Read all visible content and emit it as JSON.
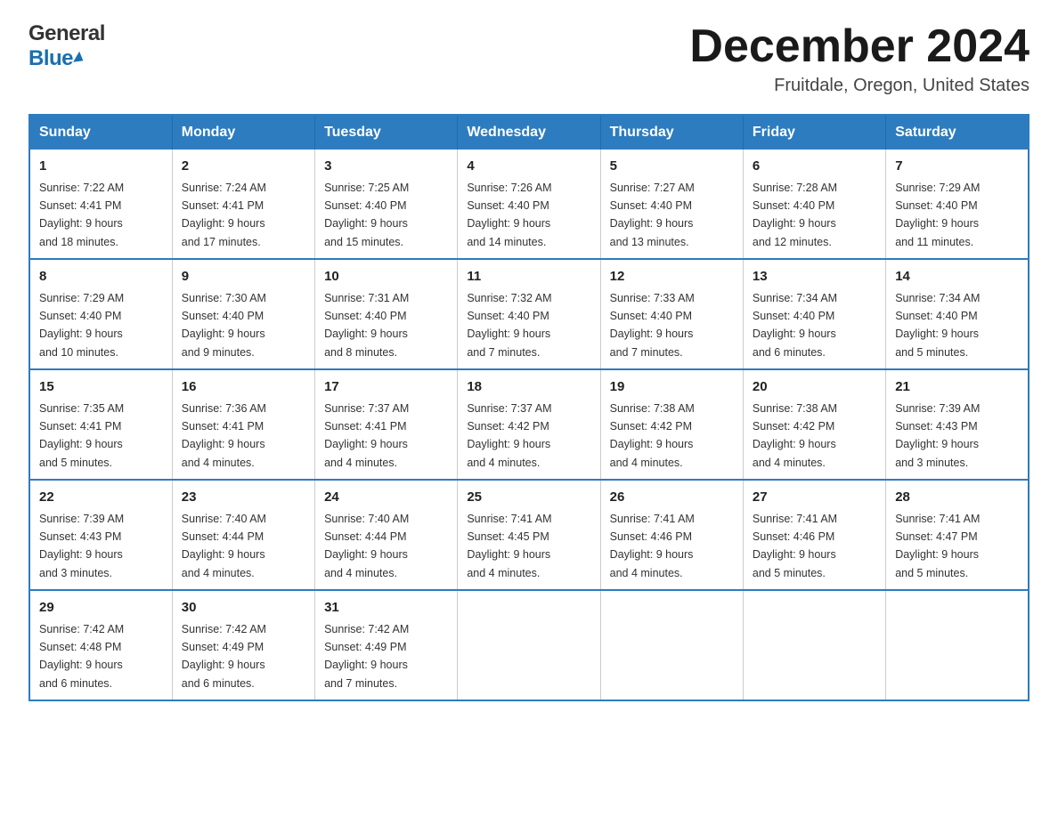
{
  "header": {
    "logo_general": "General",
    "logo_blue": "Blue",
    "month_title": "December 2024",
    "location": "Fruitdale, Oregon, United States"
  },
  "calendar": {
    "days_of_week": [
      "Sunday",
      "Monday",
      "Tuesday",
      "Wednesday",
      "Thursday",
      "Friday",
      "Saturday"
    ],
    "weeks": [
      [
        {
          "day": "1",
          "sunrise": "7:22 AM",
          "sunset": "4:41 PM",
          "daylight": "9 hours and 18 minutes."
        },
        {
          "day": "2",
          "sunrise": "7:24 AM",
          "sunset": "4:41 PM",
          "daylight": "9 hours and 17 minutes."
        },
        {
          "day": "3",
          "sunrise": "7:25 AM",
          "sunset": "4:40 PM",
          "daylight": "9 hours and 15 minutes."
        },
        {
          "day": "4",
          "sunrise": "7:26 AM",
          "sunset": "4:40 PM",
          "daylight": "9 hours and 14 minutes."
        },
        {
          "day": "5",
          "sunrise": "7:27 AM",
          "sunset": "4:40 PM",
          "daylight": "9 hours and 13 minutes."
        },
        {
          "day": "6",
          "sunrise": "7:28 AM",
          "sunset": "4:40 PM",
          "daylight": "9 hours and 12 minutes."
        },
        {
          "day": "7",
          "sunrise": "7:29 AM",
          "sunset": "4:40 PM",
          "daylight": "9 hours and 11 minutes."
        }
      ],
      [
        {
          "day": "8",
          "sunrise": "7:29 AM",
          "sunset": "4:40 PM",
          "daylight": "9 hours and 10 minutes."
        },
        {
          "day": "9",
          "sunrise": "7:30 AM",
          "sunset": "4:40 PM",
          "daylight": "9 hours and 9 minutes."
        },
        {
          "day": "10",
          "sunrise": "7:31 AM",
          "sunset": "4:40 PM",
          "daylight": "9 hours and 8 minutes."
        },
        {
          "day": "11",
          "sunrise": "7:32 AM",
          "sunset": "4:40 PM",
          "daylight": "9 hours and 7 minutes."
        },
        {
          "day": "12",
          "sunrise": "7:33 AM",
          "sunset": "4:40 PM",
          "daylight": "9 hours and 7 minutes."
        },
        {
          "day": "13",
          "sunrise": "7:34 AM",
          "sunset": "4:40 PM",
          "daylight": "9 hours and 6 minutes."
        },
        {
          "day": "14",
          "sunrise": "7:34 AM",
          "sunset": "4:40 PM",
          "daylight": "9 hours and 5 minutes."
        }
      ],
      [
        {
          "day": "15",
          "sunrise": "7:35 AM",
          "sunset": "4:41 PM",
          "daylight": "9 hours and 5 minutes."
        },
        {
          "day": "16",
          "sunrise": "7:36 AM",
          "sunset": "4:41 PM",
          "daylight": "9 hours and 4 minutes."
        },
        {
          "day": "17",
          "sunrise": "7:37 AM",
          "sunset": "4:41 PM",
          "daylight": "9 hours and 4 minutes."
        },
        {
          "day": "18",
          "sunrise": "7:37 AM",
          "sunset": "4:42 PM",
          "daylight": "9 hours and 4 minutes."
        },
        {
          "day": "19",
          "sunrise": "7:38 AM",
          "sunset": "4:42 PM",
          "daylight": "9 hours and 4 minutes."
        },
        {
          "day": "20",
          "sunrise": "7:38 AM",
          "sunset": "4:42 PM",
          "daylight": "9 hours and 4 minutes."
        },
        {
          "day": "21",
          "sunrise": "7:39 AM",
          "sunset": "4:43 PM",
          "daylight": "9 hours and 3 minutes."
        }
      ],
      [
        {
          "day": "22",
          "sunrise": "7:39 AM",
          "sunset": "4:43 PM",
          "daylight": "9 hours and 3 minutes."
        },
        {
          "day": "23",
          "sunrise": "7:40 AM",
          "sunset": "4:44 PM",
          "daylight": "9 hours and 4 minutes."
        },
        {
          "day": "24",
          "sunrise": "7:40 AM",
          "sunset": "4:44 PM",
          "daylight": "9 hours and 4 minutes."
        },
        {
          "day": "25",
          "sunrise": "7:41 AM",
          "sunset": "4:45 PM",
          "daylight": "9 hours and 4 minutes."
        },
        {
          "day": "26",
          "sunrise": "7:41 AM",
          "sunset": "4:46 PM",
          "daylight": "9 hours and 4 minutes."
        },
        {
          "day": "27",
          "sunrise": "7:41 AM",
          "sunset": "4:46 PM",
          "daylight": "9 hours and 5 minutes."
        },
        {
          "day": "28",
          "sunrise": "7:41 AM",
          "sunset": "4:47 PM",
          "daylight": "9 hours and 5 minutes."
        }
      ],
      [
        {
          "day": "29",
          "sunrise": "7:42 AM",
          "sunset": "4:48 PM",
          "daylight": "9 hours and 6 minutes."
        },
        {
          "day": "30",
          "sunrise": "7:42 AM",
          "sunset": "4:49 PM",
          "daylight": "9 hours and 6 minutes."
        },
        {
          "day": "31",
          "sunrise": "7:42 AM",
          "sunset": "4:49 PM",
          "daylight": "9 hours and 7 minutes."
        },
        null,
        null,
        null,
        null
      ]
    ]
  },
  "labels": {
    "sunrise": "Sunrise:",
    "sunset": "Sunset:",
    "daylight": "Daylight:"
  }
}
